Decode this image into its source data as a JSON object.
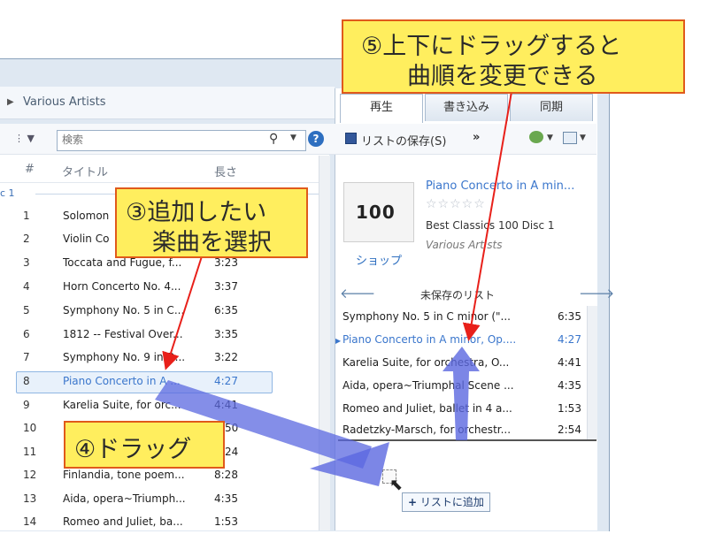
{
  "breadcrumb": {
    "item": "Various Artists"
  },
  "search": {
    "placeholder": "検索",
    "search_icon": "search-icon",
    "help_icon": "help-icon"
  },
  "library": {
    "columns": {
      "number": "#",
      "title": "タイトル",
      "length": "長さ"
    },
    "disc_label": "c 1",
    "rows": [
      {
        "num": "1",
        "title": "Solomon",
        "length": ""
      },
      {
        "num": "2",
        "title": "Violin Co",
        "length": ""
      },
      {
        "num": "3",
        "title": "Toccata and Fugue, f...",
        "length": "3:23"
      },
      {
        "num": "4",
        "title": "Horn Concerto No. 4...",
        "length": "3:37"
      },
      {
        "num": "5",
        "title": "Symphony No. 5 in C...",
        "length": "6:35"
      },
      {
        "num": "6",
        "title": "1812 -- Festival Over...",
        "length": "3:35"
      },
      {
        "num": "7",
        "title": "Symphony No. 9 in D...",
        "length": "3:22"
      },
      {
        "num": "8",
        "title": "Piano Concerto in A ...",
        "length": "4:27",
        "selected": true
      },
      {
        "num": "9",
        "title": "Karelia Suite, for orc...",
        "length": "4:41"
      },
      {
        "num": "10",
        "title": "",
        "length": "50"
      },
      {
        "num": "11",
        "title": "",
        "length": "24"
      },
      {
        "num": "12",
        "title": "Finlandia, tone poem...",
        "length": "8:28"
      },
      {
        "num": "13",
        "title": "Aida, opera~Triumph...",
        "length": "4:35"
      },
      {
        "num": "14",
        "title": "Romeo and Juliet, ba...",
        "length": "1:53"
      }
    ]
  },
  "tabs": {
    "play": "再生",
    "burn": "書き込み",
    "sync": "同期"
  },
  "toolbar": {
    "save_list": "リストの保存(S)",
    "more": "»"
  },
  "now_playing": {
    "art_text": "100",
    "title": "Piano Concerto in A min...",
    "stars": "☆☆☆☆☆",
    "album": "Best Classics 100 Disc 1",
    "artist": "Various Artists",
    "shop": "ショップ"
  },
  "playlist": {
    "name": "未保存のリスト",
    "prev_icon": "arrow-left-icon",
    "next_icon": "arrow-right-icon",
    "items": [
      {
        "title": "Symphony No. 5 in C minor (\"...",
        "length": "6:35"
      },
      {
        "title": "Piano Concerto in A minor, Op....",
        "length": "4:27",
        "current": true
      },
      {
        "title": "Karelia Suite, for orchestra, O...",
        "length": "4:41"
      },
      {
        "title": "Aida, opera~Triumphal Scene ...",
        "length": "4:35"
      },
      {
        "title": "Romeo and Juliet, ballet in 4 a...",
        "length": "1:53"
      },
      {
        "title": "Radetzky-Marsch, for orchestr...",
        "length": "2:54"
      }
    ]
  },
  "drag": {
    "tooltip": "リストに追加",
    "plus": "+"
  },
  "annotations": {
    "step5_line1": "⑤上下にドラッグすると",
    "step5_line2": "曲順を変更できる",
    "step3_line1": "③追加したい",
    "step3_line2": "楽曲を選択",
    "step4": "④ドラッグ"
  },
  "colors": {
    "callout_fill": "#ffee5e",
    "callout_border": "#e05a1b",
    "arrow_red": "#e8201a",
    "drag_arrow": "#5b68e0",
    "link_blue": "#3a76cc"
  }
}
